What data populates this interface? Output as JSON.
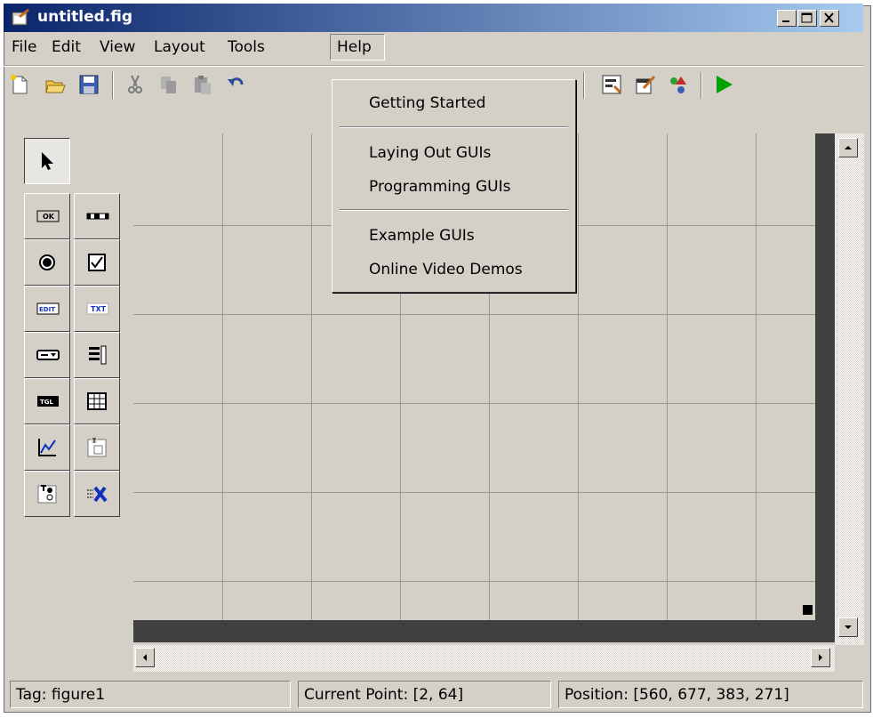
{
  "window": {
    "title": "untitled.fig"
  },
  "menubar": {
    "items": [
      {
        "label": "File"
      },
      {
        "label": "Edit"
      },
      {
        "label": "View"
      },
      {
        "label": "Layout"
      },
      {
        "label": "Tools"
      },
      {
        "label": "Help"
      }
    ]
  },
  "help_menu": {
    "items": [
      {
        "label": "Getting Started"
      },
      {
        "label": "Laying Out GUIs"
      },
      {
        "label": "Programming GUIs"
      },
      {
        "label": "Example GUIs"
      },
      {
        "label": "Online Video Demos"
      }
    ]
  },
  "toolbar": {
    "icons": [
      "new-file-icon",
      "open-folder-icon",
      "save-icon",
      "cut-icon",
      "copy-icon",
      "paste-icon",
      "undo-icon",
      "align-objects-icon",
      "menu-editor-icon",
      "property-inspector-icon",
      "object-browser-icon",
      "run-figure-icon"
    ],
    "run_color": "#00a000"
  },
  "palette": {
    "icons": [
      "select-arrow-icon",
      "push-button-icon",
      "slider-icon",
      "radio-button-icon",
      "check-box-icon",
      "edit-text-icon",
      "static-text-icon",
      "popup-menu-icon",
      "listbox-icon",
      "toggle-button-icon",
      "table-icon",
      "axes-icon",
      "panel-icon",
      "button-group-icon",
      "activex-control-icon"
    ],
    "labels": {
      "ok": "OK",
      "edit": "EDIT",
      "txt": "TXT",
      "tgl": "TGL"
    }
  },
  "status": {
    "tag": "Tag: figure1",
    "current_point": "Current Point:  [2, 64]",
    "position": "Position: [560, 677, 383, 271]"
  },
  "colors": {
    "face": "#d4d0c8",
    "titlebar_start": "#0a246a",
    "titlebar_end": "#a6caf0",
    "canvas_edge": "#404040",
    "grid": "#9c9a96"
  }
}
